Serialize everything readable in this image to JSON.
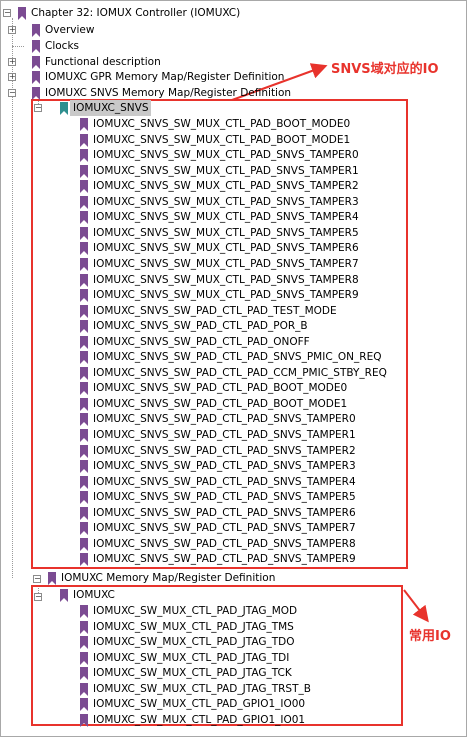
{
  "colors": {
    "bookmark_purple": "#7b4b92",
    "bookmark_teal": "#2f8f8f",
    "annotation_red": "#e8332c"
  },
  "tree": {
    "chapter": "Chapter 32: IOMUX Controller (IOMUXC)",
    "sections": [
      "Overview",
      "Clocks",
      "Functional description",
      "IOMUXC GPR Memory Map/Register Definition",
      "IOMUXC SNVS Memory Map/Register Definition"
    ],
    "snvs_group": "IOMUXC_SNVS",
    "snvs_items": [
      "IOMUXC_SNVS_SW_MUX_CTL_PAD_BOOT_MODE0",
      "IOMUXC_SNVS_SW_MUX_CTL_PAD_BOOT_MODE1",
      "IOMUXC_SNVS_SW_MUX_CTL_PAD_SNVS_TAMPER0",
      "IOMUXC_SNVS_SW_MUX_CTL_PAD_SNVS_TAMPER1",
      "IOMUXC_SNVS_SW_MUX_CTL_PAD_SNVS_TAMPER2",
      "IOMUXC_SNVS_SW_MUX_CTL_PAD_SNVS_TAMPER3",
      "IOMUXC_SNVS_SW_MUX_CTL_PAD_SNVS_TAMPER4",
      "IOMUXC_SNVS_SW_MUX_CTL_PAD_SNVS_TAMPER5",
      "IOMUXC_SNVS_SW_MUX_CTL_PAD_SNVS_TAMPER6",
      "IOMUXC_SNVS_SW_MUX_CTL_PAD_SNVS_TAMPER7",
      "IOMUXC_SNVS_SW_MUX_CTL_PAD_SNVS_TAMPER8",
      "IOMUXC_SNVS_SW_MUX_CTL_PAD_SNVS_TAMPER9",
      "IOMUXC_SNVS_SW_PAD_CTL_PAD_TEST_MODE",
      "IOMUXC_SNVS_SW_PAD_CTL_PAD_POR_B",
      "IOMUXC_SNVS_SW_PAD_CTL_PAD_ONOFF",
      "IOMUXC_SNVS_SW_PAD_CTL_PAD_SNVS_PMIC_ON_REQ",
      "IOMUXC_SNVS_SW_PAD_CTL_PAD_CCM_PMIC_STBY_REQ",
      "IOMUXC_SNVS_SW_PAD_CTL_PAD_BOOT_MODE0",
      "IOMUXC_SNVS_SW_PAD_CTL_PAD_BOOT_MODE1",
      "IOMUXC_SNVS_SW_PAD_CTL_PAD_SNVS_TAMPER0",
      "IOMUXC_SNVS_SW_PAD_CTL_PAD_SNVS_TAMPER1",
      "IOMUXC_SNVS_SW_PAD_CTL_PAD_SNVS_TAMPER2",
      "IOMUXC_SNVS_SW_PAD_CTL_PAD_SNVS_TAMPER3",
      "IOMUXC_SNVS_SW_PAD_CTL_PAD_SNVS_TAMPER4",
      "IOMUXC_SNVS_SW_PAD_CTL_PAD_SNVS_TAMPER5",
      "IOMUXC_SNVS_SW_PAD_CTL_PAD_SNVS_TAMPER6",
      "IOMUXC_SNVS_SW_PAD_CTL_PAD_SNVS_TAMPER7",
      "IOMUXC_SNVS_SW_PAD_CTL_PAD_SNVS_TAMPER8",
      "IOMUXC_SNVS_SW_PAD_CTL_PAD_SNVS_TAMPER9"
    ],
    "iomuxc_section": "IOMUXC Memory Map/Register Definition",
    "iomuxc_group": "IOMUXC",
    "iomuxc_items": [
      "IOMUXC_SW_MUX_CTL_PAD_JTAG_MOD",
      "IOMUXC_SW_MUX_CTL_PAD_JTAG_TMS",
      "IOMUXC_SW_MUX_CTL_PAD_JTAG_TDO",
      "IOMUXC_SW_MUX_CTL_PAD_JTAG_TDI",
      "IOMUXC_SW_MUX_CTL_PAD_JTAG_TCK",
      "IOMUXC_SW_MUX_CTL_PAD_JTAG_TRST_B",
      "IOMUXC_SW_MUX_CTL_PAD_GPIO1_IO00",
      "IOMUXC_SW_MUX_CTL_PAD_GPIO1_IO01"
    ]
  },
  "annotations": {
    "snvs": "SNVS域对应的IO",
    "common": "常用IO"
  }
}
